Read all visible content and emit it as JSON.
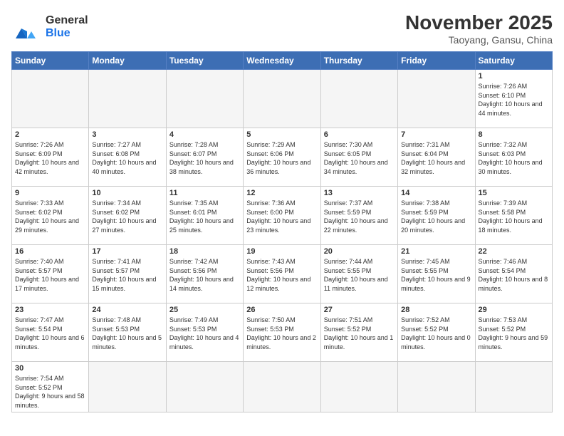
{
  "header": {
    "logo_general": "General",
    "logo_blue": "Blue",
    "month_title": "November 2025",
    "location": "Taoyang, Gansu, China"
  },
  "days_of_week": [
    "Sunday",
    "Monday",
    "Tuesday",
    "Wednesday",
    "Thursday",
    "Friday",
    "Saturday"
  ],
  "weeks": [
    [
      {
        "day": "",
        "info": ""
      },
      {
        "day": "",
        "info": ""
      },
      {
        "day": "",
        "info": ""
      },
      {
        "day": "",
        "info": ""
      },
      {
        "day": "",
        "info": ""
      },
      {
        "day": "",
        "info": ""
      },
      {
        "day": "1",
        "info": "Sunrise: 7:26 AM\nSunset: 6:10 PM\nDaylight: 10 hours\nand 44 minutes."
      }
    ],
    [
      {
        "day": "2",
        "info": "Sunrise: 7:26 AM\nSunset: 6:09 PM\nDaylight: 10 hours\nand 42 minutes."
      },
      {
        "day": "3",
        "info": "Sunrise: 7:27 AM\nSunset: 6:08 PM\nDaylight: 10 hours\nand 40 minutes."
      },
      {
        "day": "4",
        "info": "Sunrise: 7:28 AM\nSunset: 6:07 PM\nDaylight: 10 hours\nand 38 minutes."
      },
      {
        "day": "5",
        "info": "Sunrise: 7:29 AM\nSunset: 6:06 PM\nDaylight: 10 hours\nand 36 minutes."
      },
      {
        "day": "6",
        "info": "Sunrise: 7:30 AM\nSunset: 6:05 PM\nDaylight: 10 hours\nand 34 minutes."
      },
      {
        "day": "7",
        "info": "Sunrise: 7:31 AM\nSunset: 6:04 PM\nDaylight: 10 hours\nand 32 minutes."
      },
      {
        "day": "8",
        "info": "Sunrise: 7:32 AM\nSunset: 6:03 PM\nDaylight: 10 hours\nand 30 minutes."
      }
    ],
    [
      {
        "day": "9",
        "info": "Sunrise: 7:33 AM\nSunset: 6:02 PM\nDaylight: 10 hours\nand 29 minutes."
      },
      {
        "day": "10",
        "info": "Sunrise: 7:34 AM\nSunset: 6:02 PM\nDaylight: 10 hours\nand 27 minutes."
      },
      {
        "day": "11",
        "info": "Sunrise: 7:35 AM\nSunset: 6:01 PM\nDaylight: 10 hours\nand 25 minutes."
      },
      {
        "day": "12",
        "info": "Sunrise: 7:36 AM\nSunset: 6:00 PM\nDaylight: 10 hours\nand 23 minutes."
      },
      {
        "day": "13",
        "info": "Sunrise: 7:37 AM\nSunset: 5:59 PM\nDaylight: 10 hours\nand 22 minutes."
      },
      {
        "day": "14",
        "info": "Sunrise: 7:38 AM\nSunset: 5:59 PM\nDaylight: 10 hours\nand 20 minutes."
      },
      {
        "day": "15",
        "info": "Sunrise: 7:39 AM\nSunset: 5:58 PM\nDaylight: 10 hours\nand 18 minutes."
      }
    ],
    [
      {
        "day": "16",
        "info": "Sunrise: 7:40 AM\nSunset: 5:57 PM\nDaylight: 10 hours\nand 17 minutes."
      },
      {
        "day": "17",
        "info": "Sunrise: 7:41 AM\nSunset: 5:57 PM\nDaylight: 10 hours\nand 15 minutes."
      },
      {
        "day": "18",
        "info": "Sunrise: 7:42 AM\nSunset: 5:56 PM\nDaylight: 10 hours\nand 14 minutes."
      },
      {
        "day": "19",
        "info": "Sunrise: 7:43 AM\nSunset: 5:56 PM\nDaylight: 10 hours\nand 12 minutes."
      },
      {
        "day": "20",
        "info": "Sunrise: 7:44 AM\nSunset: 5:55 PM\nDaylight: 10 hours\nand 11 minutes."
      },
      {
        "day": "21",
        "info": "Sunrise: 7:45 AM\nSunset: 5:55 PM\nDaylight: 10 hours\nand 9 minutes."
      },
      {
        "day": "22",
        "info": "Sunrise: 7:46 AM\nSunset: 5:54 PM\nDaylight: 10 hours\nand 8 minutes."
      }
    ],
    [
      {
        "day": "23",
        "info": "Sunrise: 7:47 AM\nSunset: 5:54 PM\nDaylight: 10 hours\nand 6 minutes."
      },
      {
        "day": "24",
        "info": "Sunrise: 7:48 AM\nSunset: 5:53 PM\nDaylight: 10 hours\nand 5 minutes."
      },
      {
        "day": "25",
        "info": "Sunrise: 7:49 AM\nSunset: 5:53 PM\nDaylight: 10 hours\nand 4 minutes."
      },
      {
        "day": "26",
        "info": "Sunrise: 7:50 AM\nSunset: 5:53 PM\nDaylight: 10 hours\nand 2 minutes."
      },
      {
        "day": "27",
        "info": "Sunrise: 7:51 AM\nSunset: 5:52 PM\nDaylight: 10 hours\nand 1 minute."
      },
      {
        "day": "28",
        "info": "Sunrise: 7:52 AM\nSunset: 5:52 PM\nDaylight: 10 hours\nand 0 minutes."
      },
      {
        "day": "29",
        "info": "Sunrise: 7:53 AM\nSunset: 5:52 PM\nDaylight: 9 hours\nand 59 minutes."
      }
    ],
    [
      {
        "day": "30",
        "info": "Sunrise: 7:54 AM\nSunset: 5:52 PM\nDaylight: 9 hours\nand 58 minutes."
      },
      {
        "day": "",
        "info": ""
      },
      {
        "day": "",
        "info": ""
      },
      {
        "day": "",
        "info": ""
      },
      {
        "day": "",
        "info": ""
      },
      {
        "day": "",
        "info": ""
      },
      {
        "day": "",
        "info": ""
      }
    ]
  ]
}
